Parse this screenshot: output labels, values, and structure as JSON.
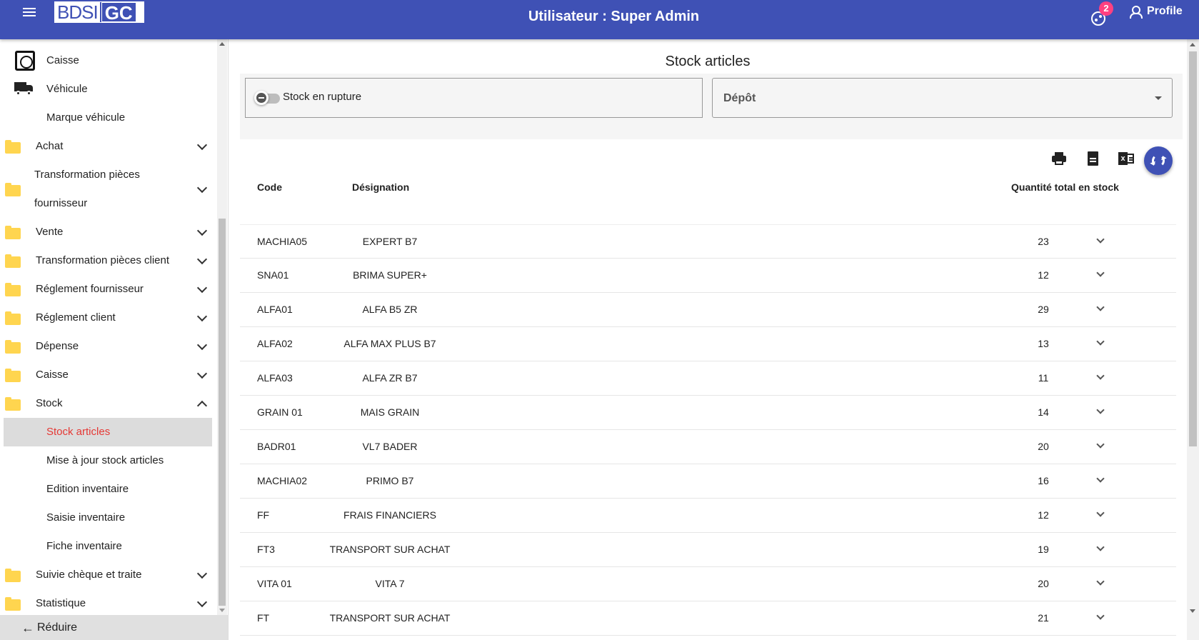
{
  "app": {
    "logo_part1": "BDSI",
    "logo_part2": "GC",
    "title": "Utilisateur : Super Admin",
    "notification_count": "2",
    "profile_label": "Profile"
  },
  "sidebar": {
    "items": [
      {
        "label": "Caisse"
      },
      {
        "label": "Véhicule"
      },
      {
        "label": "Marque véhicule"
      },
      {
        "label": "Achat"
      },
      {
        "label": "Transformation pièces fournisseur"
      },
      {
        "label": "Vente"
      },
      {
        "label": "Transformation pièces client"
      },
      {
        "label": "Réglement fournisseur"
      },
      {
        "label": "Réglement client"
      },
      {
        "label": "Dépense"
      },
      {
        "label": "Caisse"
      },
      {
        "label": "Stock"
      },
      {
        "label": "Stock articles"
      },
      {
        "label": "Mise à jour stock articles"
      },
      {
        "label": "Edition inventaire"
      },
      {
        "label": "Saisie inventaire"
      },
      {
        "label": "Fiche inventaire"
      },
      {
        "label": "Suivie chèque et traite"
      },
      {
        "label": "Statistique"
      }
    ],
    "reduce_label": "Réduire"
  },
  "main": {
    "page_title": "Stock articles",
    "filter_toggle_label": "Stock en rupture",
    "depot_label": "Dépôt",
    "columns": {
      "code": "Code",
      "designation": "Désignation",
      "quantity": "Quantité total en stock"
    },
    "rows": [
      {
        "code": "MACHIA05",
        "designation": "EXPERT B7",
        "quantity": "23"
      },
      {
        "code": "SNA01",
        "designation": "BRIMA SUPER+",
        "quantity": "12"
      },
      {
        "code": "ALFA01",
        "designation": "ALFA B5 ZR",
        "quantity": "29"
      },
      {
        "code": "ALFA02",
        "designation": "ALFA MAX PLUS B7",
        "quantity": "13"
      },
      {
        "code": "ALFA03",
        "designation": "ALFA ZR B7",
        "quantity": "11"
      },
      {
        "code": "GRAIN 01",
        "designation": "MAIS GRAIN",
        "quantity": "14"
      },
      {
        "code": "BADR01",
        "designation": "VL7 BADER",
        "quantity": "20"
      },
      {
        "code": "MACHIA02",
        "designation": "PRIMO B7",
        "quantity": "16"
      },
      {
        "code": "FF",
        "designation": "FRAIS FINANCIERS",
        "quantity": "12"
      },
      {
        "code": "FT3",
        "designation": "TRANSPORT SUR ACHAT",
        "quantity": "19"
      },
      {
        "code": "VITA 01",
        "designation": "VITA 7",
        "quantity": "20"
      },
      {
        "code": "FT",
        "designation": "TRANSPORT SUR ACHAT",
        "quantity": "21"
      }
    ]
  },
  "colors": {
    "primary": "#3f51b5",
    "badge": "#ff4081",
    "active_text": "#e53935",
    "folder": "#ffd54f"
  },
  "icons": [
    "menu-icon",
    "notification-icon",
    "profile-icon",
    "safe-icon",
    "truck-icon",
    "folder-icon",
    "printer-icon",
    "document-icon",
    "excel-icon",
    "refresh-icon",
    "chevron-down-icon",
    "chevron-up-icon",
    "arrow-left-icon"
  ]
}
